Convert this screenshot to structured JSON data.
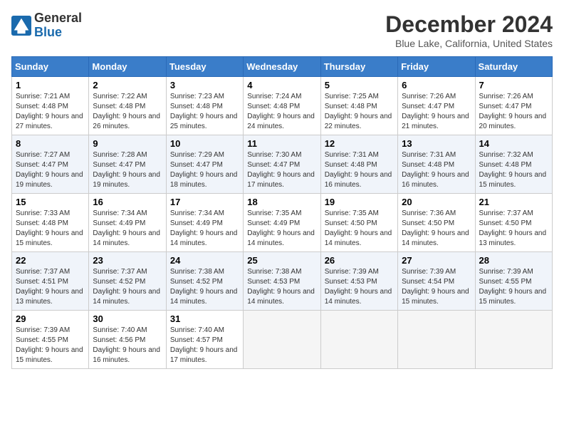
{
  "logo": {
    "general": "General",
    "blue": "Blue"
  },
  "title": "December 2024",
  "location": "Blue Lake, California, United States",
  "days_of_week": [
    "Sunday",
    "Monday",
    "Tuesday",
    "Wednesday",
    "Thursday",
    "Friday",
    "Saturday"
  ],
  "weeks": [
    [
      {
        "day": 1,
        "sunrise": "7:21 AM",
        "sunset": "4:48 PM",
        "daylight": "9 hours and 27 minutes."
      },
      {
        "day": 2,
        "sunrise": "7:22 AM",
        "sunset": "4:48 PM",
        "daylight": "9 hours and 26 minutes."
      },
      {
        "day": 3,
        "sunrise": "7:23 AM",
        "sunset": "4:48 PM",
        "daylight": "9 hours and 25 minutes."
      },
      {
        "day": 4,
        "sunrise": "7:24 AM",
        "sunset": "4:48 PM",
        "daylight": "9 hours and 24 minutes."
      },
      {
        "day": 5,
        "sunrise": "7:25 AM",
        "sunset": "4:48 PM",
        "daylight": "9 hours and 22 minutes."
      },
      {
        "day": 6,
        "sunrise": "7:26 AM",
        "sunset": "4:47 PM",
        "daylight": "9 hours and 21 minutes."
      },
      {
        "day": 7,
        "sunrise": "7:26 AM",
        "sunset": "4:47 PM",
        "daylight": "9 hours and 20 minutes."
      }
    ],
    [
      {
        "day": 8,
        "sunrise": "7:27 AM",
        "sunset": "4:47 PM",
        "daylight": "9 hours and 19 minutes."
      },
      {
        "day": 9,
        "sunrise": "7:28 AM",
        "sunset": "4:47 PM",
        "daylight": "9 hours and 19 minutes."
      },
      {
        "day": 10,
        "sunrise": "7:29 AM",
        "sunset": "4:47 PM",
        "daylight": "9 hours and 18 minutes."
      },
      {
        "day": 11,
        "sunrise": "7:30 AM",
        "sunset": "4:47 PM",
        "daylight": "9 hours and 17 minutes."
      },
      {
        "day": 12,
        "sunrise": "7:31 AM",
        "sunset": "4:48 PM",
        "daylight": "9 hours and 16 minutes."
      },
      {
        "day": 13,
        "sunrise": "7:31 AM",
        "sunset": "4:48 PM",
        "daylight": "9 hours and 16 minutes."
      },
      {
        "day": 14,
        "sunrise": "7:32 AM",
        "sunset": "4:48 PM",
        "daylight": "9 hours and 15 minutes."
      }
    ],
    [
      {
        "day": 15,
        "sunrise": "7:33 AM",
        "sunset": "4:48 PM",
        "daylight": "9 hours and 15 minutes."
      },
      {
        "day": 16,
        "sunrise": "7:34 AM",
        "sunset": "4:49 PM",
        "daylight": "9 hours and 14 minutes."
      },
      {
        "day": 17,
        "sunrise": "7:34 AM",
        "sunset": "4:49 PM",
        "daylight": "9 hours and 14 minutes."
      },
      {
        "day": 18,
        "sunrise": "7:35 AM",
        "sunset": "4:49 PM",
        "daylight": "9 hours and 14 minutes."
      },
      {
        "day": 19,
        "sunrise": "7:35 AM",
        "sunset": "4:50 PM",
        "daylight": "9 hours and 14 minutes."
      },
      {
        "day": 20,
        "sunrise": "7:36 AM",
        "sunset": "4:50 PM",
        "daylight": "9 hours and 14 minutes."
      },
      {
        "day": 21,
        "sunrise": "7:37 AM",
        "sunset": "4:50 PM",
        "daylight": "9 hours and 13 minutes."
      }
    ],
    [
      {
        "day": 22,
        "sunrise": "7:37 AM",
        "sunset": "4:51 PM",
        "daylight": "9 hours and 13 minutes."
      },
      {
        "day": 23,
        "sunrise": "7:37 AM",
        "sunset": "4:52 PM",
        "daylight": "9 hours and 14 minutes."
      },
      {
        "day": 24,
        "sunrise": "7:38 AM",
        "sunset": "4:52 PM",
        "daylight": "9 hours and 14 minutes."
      },
      {
        "day": 25,
        "sunrise": "7:38 AM",
        "sunset": "4:53 PM",
        "daylight": "9 hours and 14 minutes."
      },
      {
        "day": 26,
        "sunrise": "7:39 AM",
        "sunset": "4:53 PM",
        "daylight": "9 hours and 14 minutes."
      },
      {
        "day": 27,
        "sunrise": "7:39 AM",
        "sunset": "4:54 PM",
        "daylight": "9 hours and 15 minutes."
      },
      {
        "day": 28,
        "sunrise": "7:39 AM",
        "sunset": "4:55 PM",
        "daylight": "9 hours and 15 minutes."
      }
    ],
    [
      {
        "day": 29,
        "sunrise": "7:39 AM",
        "sunset": "4:55 PM",
        "daylight": "9 hours and 15 minutes."
      },
      {
        "day": 30,
        "sunrise": "7:40 AM",
        "sunset": "4:56 PM",
        "daylight": "9 hours and 16 minutes."
      },
      {
        "day": 31,
        "sunrise": "7:40 AM",
        "sunset": "4:57 PM",
        "daylight": "9 hours and 17 minutes."
      },
      null,
      null,
      null,
      null
    ]
  ],
  "labels": {
    "sunrise": "Sunrise:",
    "sunset": "Sunset:",
    "daylight": "Daylight:"
  }
}
